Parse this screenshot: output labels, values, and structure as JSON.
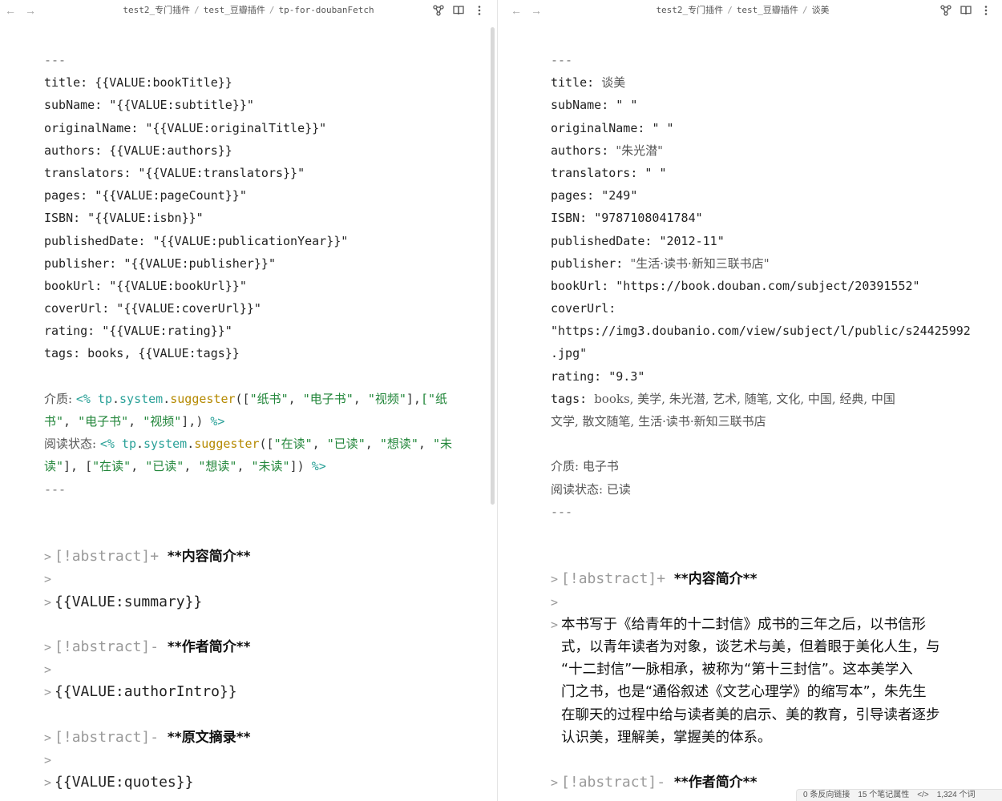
{
  "left": {
    "breadcrumb": [
      "test2_专门插件",
      "test_豆瓣插件",
      "tp-for-doubanFetch"
    ],
    "frontmatter": [
      "---",
      "title: {{VALUE:bookTitle}}",
      "subName: \"{{VALUE:subtitle}}\"",
      "originalName: \"{{VALUE:originalTitle}}\"",
      "authors: {{VALUE:authors}}",
      "translators: \"{{VALUE:translators}}\"",
      "pages: \"{{VALUE:pageCount}}\"",
      "ISBN: \"{{VALUE:isbn}}\"",
      "publishedDate: \"{{VALUE:publicationYear}}\"",
      "publisher: \"{{VALUE:publisher}}\"",
      "bookUrl: \"{{VALUE:bookUrl}}\"",
      "coverUrl: \"{{VALUE:coverUrl}}\"",
      "rating: \"{{VALUE:rating}}\"",
      "tags: books, {{VALUE:tags}}"
    ],
    "medium_key": "介质: ",
    "read_key": "阅读状态: ",
    "tp_open": "<%",
    "tp_close": "%>",
    "tp_obj": "tp",
    "tp_sys": "system",
    "tp_fn": "suggester",
    "medium_opts": [
      "\"纸书\"",
      "\"电子书\"",
      "\"视频\""
    ],
    "medium_opts_b1": "[\"纸",
    "medium_opts_b2": "书\"",
    "read_opts": [
      "\"在读\"",
      "\"已读\"",
      "\"想读\""
    ],
    "read_opt4_a": "\"未",
    "read_opt4_b": "读\"",
    "read_opts_b": [
      "\"在读\"",
      "\"已读\"",
      "\"想读\"",
      "\"未读\""
    ],
    "fm_end": "---",
    "callouts": [
      {
        "type": "[!abstract]+",
        "title": "**内容简介**",
        "body": "{{VALUE:summary}}"
      },
      {
        "type": "[!abstract]-",
        "title": "**作者简介**",
        "body": "{{VALUE:authorIntro}}"
      },
      {
        "type": "[!abstract]-",
        "title": "**原文摘录**",
        "body": "{{VALUE:quotes}}"
      }
    ]
  },
  "right": {
    "breadcrumb": [
      "test2_专门插件",
      "test_豆瓣插件",
      "谈美"
    ],
    "props": [
      {
        "key": "---",
        "val": ""
      },
      {
        "key": "title: ",
        "val": "谈美"
      },
      {
        "key": "subName: ",
        "val": "\" \""
      },
      {
        "key": "originalName: ",
        "val": "\" \""
      },
      {
        "key": "authors: ",
        "val": "\"朱光潜\""
      },
      {
        "key": "translators: ",
        "val": "\" \""
      },
      {
        "key": "pages: ",
        "val": "\"249\""
      },
      {
        "key": "ISBN: ",
        "val": "\"9787108041784\""
      },
      {
        "key": "publishedDate: ",
        "val": "\"2012-11\""
      },
      {
        "key": "publisher: ",
        "val": "\"生活·读书·新知三联书店\""
      },
      {
        "key": "bookUrl: ",
        "val": "\"https://book.douban.com/subject/20391552\""
      },
      {
        "key": "coverUrl:",
        "val": ""
      },
      {
        "key": "",
        "val": "\"https://img3.doubanio.com/view/subject/l/public/s24425992"
      },
      {
        "key": "",
        "val": ".jpg\""
      },
      {
        "key": "rating: ",
        "val": "\"9.3\""
      },
      {
        "key": "tags: ",
        "val": "books, 美学, 朱光潜, 艺术, 随笔, 文化, 中国, 经典, 中国"
      },
      {
        "key": "",
        "val": "文学, 散文随笔, 生活·读书·新知三联书店"
      }
    ],
    "medium": {
      "key": "介质: ",
      "val": "电子书"
    },
    "read_status": {
      "key": "阅读状态: ",
      "val": "已读"
    },
    "fm_end": "---",
    "callout1": {
      "type": "[!abstract]+",
      "title": "**内容简介**"
    },
    "summary_lines": [
      "本书写于《给青年的十二封信》成书的三年之后，以书信形",
      "式，以青年读者为对象，谈艺术与美，但着眼于美化人生，与",
      "“十二封信”一脉相承，被称为“第十三封信”。这本美学入",
      "门之书，也是“通俗叙述《文艺心理学》的缩写本”，朱先生",
      "在聊天的过程中给与读者美的启示、美的教育，引导读者逐步",
      "认识美，理解美，掌握美的体系。"
    ],
    "callout2": {
      "type": "[!abstract]-",
      "title": "**作者简介**"
    }
  },
  "gt": ">",
  "status_bar": {
    "backlinks": "0 条反向链接",
    "props": "15 个笔记属性",
    "words": "1,324 个词"
  }
}
